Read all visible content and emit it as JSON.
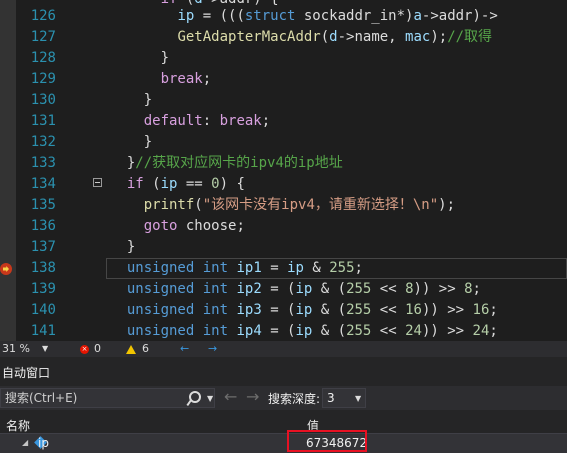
{
  "editor": {
    "lines": [
      {
        "num": "126",
        "html": "        <span class=\"var\">ip</span> = (((<span class=\"kw\">struct</span> sockaddr_in*)<span class=\"var\">a</span>-&gt;addr)-&gt;"
      },
      {
        "num": "127",
        "html": "        <span class=\"fn\">GetAdapterMacAddr</span>(<span class=\"var\">d</span>-&gt;name, <span class=\"var\">mac</span>);<span class=\"cm\">//取得</span>"
      },
      {
        "num": "128",
        "html": "      }"
      },
      {
        "num": "129",
        "html": "      <span class=\"ctl\">break</span>;"
      },
      {
        "num": "130",
        "html": "    }"
      },
      {
        "num": "131",
        "html": "    <span class=\"ctl\">default</span>: <span class=\"ctl\">break</span>;"
      },
      {
        "num": "132",
        "html": "    }"
      },
      {
        "num": "133",
        "html": "  }<span class=\"cm\">//获取对应网卡的ipv4的ip地址</span>"
      },
      {
        "num": "134",
        "html": "  <span class=\"ctl\">if</span> (<span class=\"var\">ip</span> == <span class=\"num\">0</span>) {"
      },
      {
        "num": "135",
        "html": "    <span class=\"fn\">printf</span>(<span class=\"str\">\"该网卡没有ipv4，请重新选择！\\n\"</span>);"
      },
      {
        "num": "136",
        "html": "    <span class=\"ctl\">goto</span> choose;"
      },
      {
        "num": "137",
        "html": "  }"
      },
      {
        "num": "138",
        "html": "  <span class=\"kw\">unsigned</span> <span class=\"kw\">int</span> <span class=\"var\">ip1</span> = <span class=\"var\">ip</span> &amp; <span class=\"num\">255</span>;"
      },
      {
        "num": "139",
        "html": "  <span class=\"kw\">unsigned</span> <span class=\"kw\">int</span> <span class=\"var\">ip2</span> = (<span class=\"var\">ip</span> &amp; (<span class=\"num\">255</span> &lt;&lt; <span class=\"num\">8</span>)) &gt;&gt; <span class=\"num\">8</span>;"
      },
      {
        "num": "140",
        "html": "  <span class=\"kw\">unsigned</span> <span class=\"kw\">int</span> <span class=\"var\">ip3</span> = (<span class=\"var\">ip</span> &amp; (<span class=\"num\">255</span> &lt;&lt; <span class=\"num\">16</span>)) &gt;&gt; <span class=\"num\">16</span>;"
      },
      {
        "num": "141",
        "html": "  <span class=\"kw\">unsigned</span> <span class=\"kw\">int</span> <span class=\"var\">ip4</span> = (<span class=\"var\">ip</span> &amp; (<span class=\"num\">255</span> &lt;&lt; <span class=\"num\">24</span>)) &gt;&gt; <span class=\"num\">24</span>;"
      }
    ],
    "top_partial": "      <span class=\"ctl\">if</span> (<span class=\"var\">d</span>-&gt;addr) {"
  },
  "status": {
    "zoom": "31 %",
    "errors": "0",
    "warnings": "6"
  },
  "autos": {
    "title": "自动窗口",
    "search_placeholder": "搜索(Ctrl+E)",
    "depth_label": "搜索深度:",
    "depth_value": "3",
    "col_name": "名称",
    "col_value": "值",
    "row_name": "ip",
    "row_value": "67348672"
  }
}
